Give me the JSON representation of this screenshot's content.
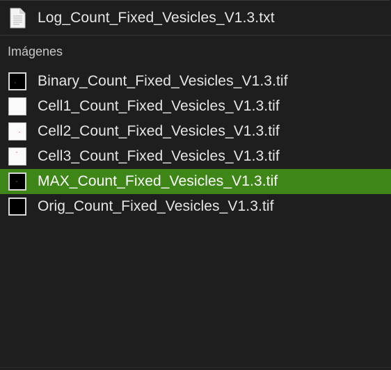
{
  "log_file": {
    "name": "Log_Count_Fixed_Vesicles_V1.3.txt",
    "icon": "text-document-icon"
  },
  "images_section": {
    "header": "Imágenes",
    "items": [
      {
        "name": "Binary_Count_Fixed_Vesicles_V1.3.tif",
        "thumbnail": "dark",
        "selected": false
      },
      {
        "name": "Cell1_Count_Fixed_Vesicles_V1.3.tif",
        "thumbnail": "light",
        "selected": false
      },
      {
        "name": "Cell2_Count_Fixed_Vesicles_V1.3.tif",
        "thumbnail": "light",
        "selected": false
      },
      {
        "name": "Cell3_Count_Fixed_Vesicles_V1.3.tif",
        "thumbnail": "light",
        "selected": false
      },
      {
        "name": "MAX_Count_Fixed_Vesicles_V1.3.tif",
        "thumbnail": "dark",
        "selected": true
      },
      {
        "name": "Orig_Count_Fixed_Vesicles_V1.3.tif",
        "thumbnail": "dark",
        "selected": false
      }
    ]
  },
  "colors": {
    "background": "#1e1e1e",
    "selection": "#3e8617",
    "text": "#e6e6e6"
  }
}
